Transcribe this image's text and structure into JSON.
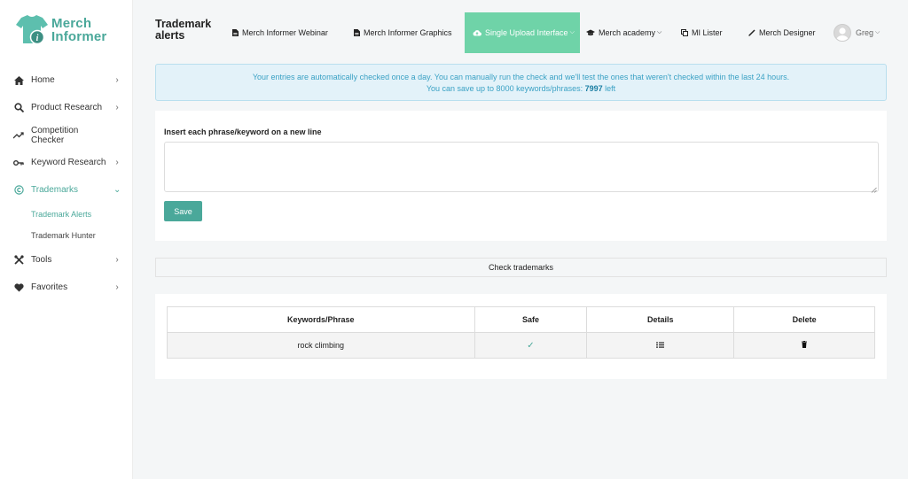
{
  "brand": {
    "line1": "Merch",
    "line2": "Informer"
  },
  "sidebar": {
    "items": [
      {
        "label": "Home",
        "icon": "home-icon",
        "has_chevron": true
      },
      {
        "label": "Product Research",
        "icon": "search-icon",
        "has_chevron": true
      },
      {
        "label": "Competition Checker",
        "icon": "trend-icon",
        "has_chevron": false
      },
      {
        "label": "Keyword Research",
        "icon": "key-icon",
        "has_chevron": true
      },
      {
        "label": "Trademarks",
        "icon": "copyright-icon",
        "has_chevron": true,
        "active": true
      },
      {
        "label": "Tools",
        "icon": "tools-icon",
        "has_chevron": true
      },
      {
        "label": "Favorites",
        "icon": "heart-icon",
        "has_chevron": true
      }
    ],
    "subitems": [
      {
        "label": "Trademark Alerts",
        "active": true
      },
      {
        "label": "Trademark Hunter",
        "active": false
      }
    ]
  },
  "header": {
    "title": "Trademark alerts",
    "nav": [
      {
        "label": "Merch Informer Webinar",
        "icon": "document-icon"
      },
      {
        "label": "Merch Informer Graphics",
        "icon": "document-icon"
      },
      {
        "label": "Single Upload Interface",
        "icon": "cloud-upload-icon",
        "dropdown": true,
        "highlight": true
      },
      {
        "label": "Merch academy",
        "icon": "graduation-cap-icon",
        "dropdown": true
      },
      {
        "label": "MI Lister",
        "icon": "copy-icon"
      },
      {
        "label": "Merch Designer",
        "icon": "pencil-icon"
      }
    ],
    "user": "Greg"
  },
  "info": {
    "line1": "Your entries are automatically checked once a day. You can manually run the check and we'll test the ones that weren't checked within the last 24 hours.",
    "line2_prefix": "You can save up to 8000 keywords/phrases: ",
    "line2_count": "7997",
    "line2_suffix": " left"
  },
  "form": {
    "label": "Insert each phrase/keyword on a new line",
    "value": "",
    "save_label": "Save"
  },
  "check_button": "Check trademarks",
  "table": {
    "columns": [
      "Keywords/Phrase",
      "Safe",
      "Details",
      "Delete"
    ],
    "rows": [
      {
        "keyword": "rock climbing",
        "safe": "✓"
      }
    ]
  },
  "colors": {
    "accent": "#4aa89a",
    "highlight_nav": "#6fd3a8",
    "info_bg": "#e3f2f9",
    "info_text": "#3aa1c4"
  }
}
